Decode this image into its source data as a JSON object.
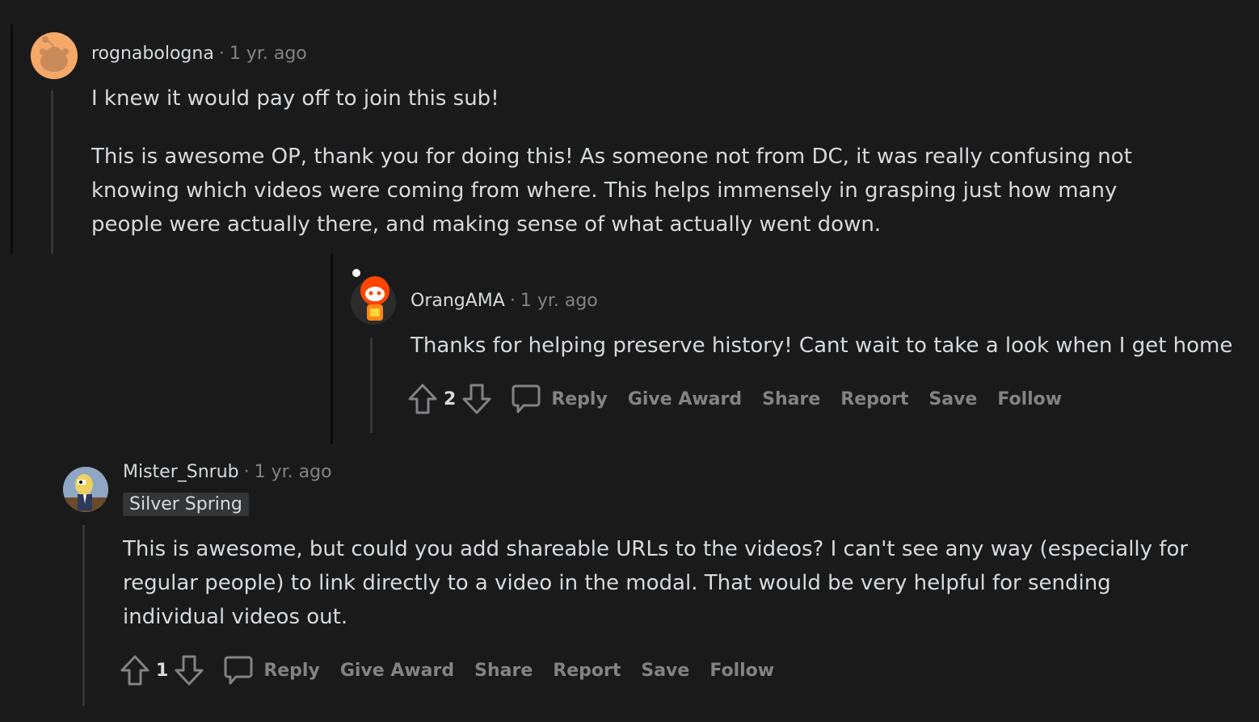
{
  "comments": [
    {
      "username": "rognabologna",
      "separator": "·",
      "time": "1 yr. ago",
      "paragraphs": [
        "I knew it would pay off to join this sub!",
        "This is awesome OP, thank you for doing this! As someone not from DC, it was really confusing not",
        "knowing which videos were coming from where. This helps immensely in grasping just how many",
        "people were actually there, and making sense of what actually went down."
      ]
    },
    {
      "username": "OrangAMA",
      "separator": "·",
      "time": "1 yr. ago",
      "body": "Thanks for helping preserve history! Cant wait to take a look when I get home",
      "score": "2",
      "actions": {
        "reply": "Reply",
        "award": "Give Award",
        "share": "Share",
        "report": "Report",
        "save": "Save",
        "follow": "Follow"
      }
    },
    {
      "username": "Mister_Snrub",
      "separator": "·",
      "time": "1 yr. ago",
      "flair": "Silver Spring",
      "lines": [
        "This is awesome, but could you add shareable URLs to the videos? I can't see any way (especially for",
        "regular people) to link directly to a video in the modal. That would be very helpful for sending",
        "individual videos out."
      ],
      "score": "1",
      "actions": {
        "reply": "Reply",
        "award": "Give Award",
        "share": "Share",
        "report": "Report",
        "save": "Save",
        "follow": "Follow"
      }
    }
  ],
  "colors": {
    "background": "#1a1a1b",
    "text": "#d7dadc",
    "muted": "#818384",
    "thread_line": "#343536",
    "avatar_orange": "#f5a868"
  },
  "icons": [
    "upvote-icon",
    "downvote-icon",
    "comment-icon",
    "snoo-avatar-icon"
  ]
}
